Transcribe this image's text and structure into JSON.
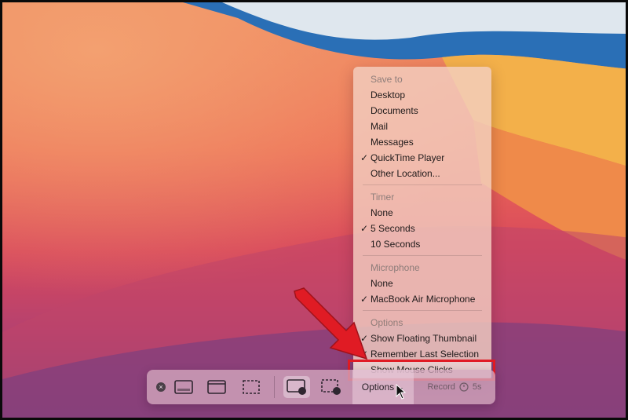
{
  "menu": {
    "sections": [
      {
        "title": "Save to",
        "items": [
          {
            "label": "Desktop",
            "checked": false
          },
          {
            "label": "Documents",
            "checked": false
          },
          {
            "label": "Mail",
            "checked": false
          },
          {
            "label": "Messages",
            "checked": false
          },
          {
            "label": "QuickTime Player",
            "checked": true
          },
          {
            "label": "Other Location...",
            "checked": false
          }
        ]
      },
      {
        "title": "Timer",
        "items": [
          {
            "label": "None",
            "checked": false
          },
          {
            "label": "5 Seconds",
            "checked": true
          },
          {
            "label": "10 Seconds",
            "checked": false
          }
        ]
      },
      {
        "title": "Microphone",
        "items": [
          {
            "label": "None",
            "checked": false
          },
          {
            "label": "MacBook Air Microphone",
            "checked": true
          }
        ]
      },
      {
        "title": "Options",
        "items": [
          {
            "label": "Show Floating Thumbnail",
            "checked": true
          },
          {
            "label": "Remember Last Selection",
            "checked": true
          },
          {
            "label": "Show Mouse Clicks",
            "checked": false,
            "highlighted": true
          }
        ]
      }
    ],
    "checkmark": "✓"
  },
  "toolbar": {
    "close_glyph": "×",
    "options_label": "Options",
    "options_chevron": "⌄",
    "record_label": "Record",
    "record_timer": "5s"
  },
  "colors": {
    "highlight_border": "#e01b24",
    "arrow": "#e01b24"
  },
  "icons": [
    "close-icon",
    "capture-entire-screen-icon",
    "capture-window-icon",
    "capture-selection-icon",
    "record-entire-screen-icon",
    "record-selection-icon",
    "chevron-down-icon",
    "timer-icon",
    "mouse-pointer-icon",
    "red-arrow-annotation"
  ]
}
